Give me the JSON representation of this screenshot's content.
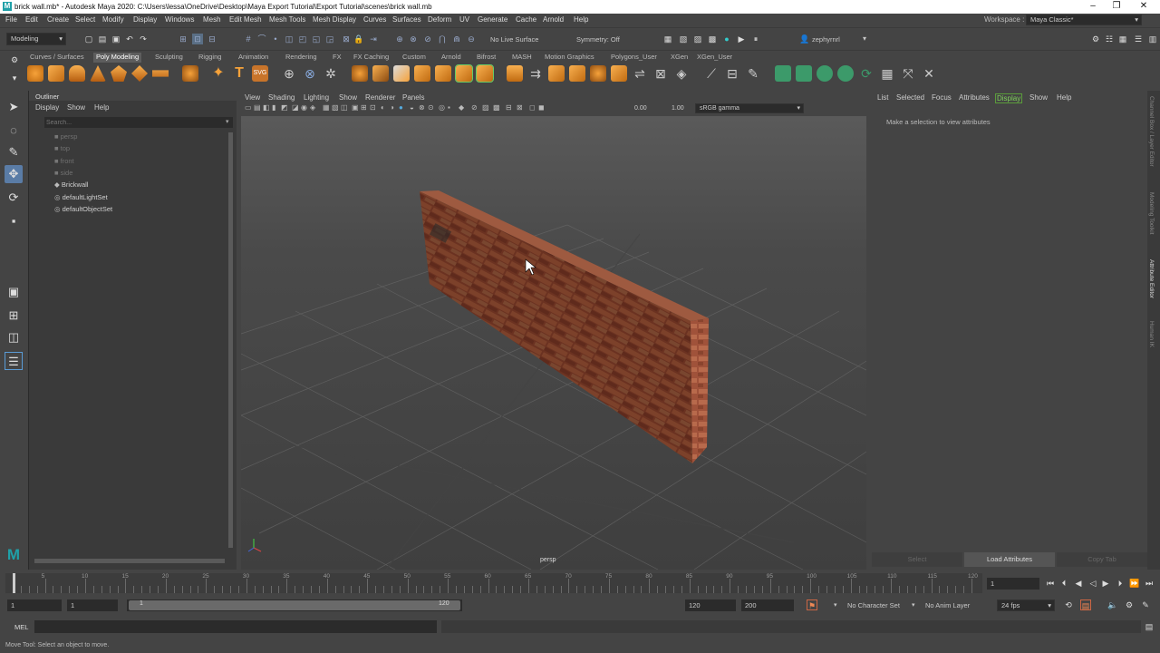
{
  "window": {
    "title": "brick wall.mb* - Autodesk Maya 2020: C:\\Users\\lessa\\OneDrive\\Desktop\\Maya Export Tutorial\\Export Tutorial\\scenes\\brick wall.mb",
    "logo": "M"
  },
  "menu": [
    "File",
    "Edit",
    "Create",
    "Select",
    "Modify",
    "Display",
    "Windows",
    "Mesh",
    "Edit Mesh",
    "Mesh Tools",
    "Mesh Display",
    "Curves",
    "Surfaces",
    "Deform",
    "UV",
    "Generate",
    "Cache",
    "Arnold",
    "Help"
  ],
  "workspace": {
    "label": "Workspace :",
    "value": "Maya Classic*"
  },
  "statusline": {
    "mode": "Modeling",
    "live_surface": "No Live Surface",
    "symmetry": "Symmetry: Off",
    "user": "zephyrnrl"
  },
  "shelf_tabs": [
    "Curves / Surfaces",
    "Poly Modeling",
    "Sculpting",
    "Rigging",
    "Animation",
    "Rendering",
    "FX",
    "FX Caching",
    "Custom",
    "Arnold",
    "Bifrost",
    "MASH",
    "Motion Graphics",
    "Polygons_User",
    "XGen",
    "XGen_User"
  ],
  "shelf_active": "Poly Modeling",
  "outliner": {
    "title": "Outliner",
    "menu": [
      "Display",
      "Show",
      "Help"
    ],
    "search_placeholder": "Search...",
    "items": [
      {
        "label": "persp",
        "dim": true
      },
      {
        "label": "top",
        "dim": true
      },
      {
        "label": "front",
        "dim": true
      },
      {
        "label": "side",
        "dim": true
      },
      {
        "label": "Brickwall",
        "dim": false
      },
      {
        "label": "defaultLightSet",
        "dim": false
      },
      {
        "label": "defaultObjectSet",
        "dim": false
      }
    ]
  },
  "viewport": {
    "menu": [
      "View",
      "Shading",
      "Lighting",
      "Show",
      "Renderer",
      "Panels"
    ],
    "exposure": "0.00",
    "gamma": "1.00",
    "colorspace": "sRGB gamma",
    "camera": "persp"
  },
  "attr": {
    "menu": [
      "List",
      "Selected",
      "Focus",
      "Attributes",
      "Display",
      "Show",
      "Help"
    ],
    "active": "Display",
    "message": "Make a selection to view attributes",
    "buttons": [
      "Select",
      "Load Attributes",
      "Copy Tab"
    ]
  },
  "side_tabs": [
    "Channel Box / Layer Editor",
    "Modeling Toolkit",
    "Attribute Editor",
    "Human IK"
  ],
  "timeline": {
    "ticks": [
      "5",
      "10",
      "15",
      "20",
      "25",
      "30",
      "35",
      "40",
      "45",
      "50",
      "55",
      "60",
      "65",
      "70",
      "75",
      "80",
      "85",
      "90",
      "95",
      "100",
      "105",
      "110",
      "115",
      "120"
    ],
    "current_frame": "1"
  },
  "range": {
    "start": "1",
    "start2": "1",
    "slider_start": "1",
    "slider_end": "120",
    "end": "120",
    "end2": "200",
    "char_set": "No Character Set",
    "anim_layer": "No Anim Layer",
    "fps": "24 fps"
  },
  "cmd": {
    "label": "MEL"
  },
  "help_line": "Move Tool: Select an object to move."
}
